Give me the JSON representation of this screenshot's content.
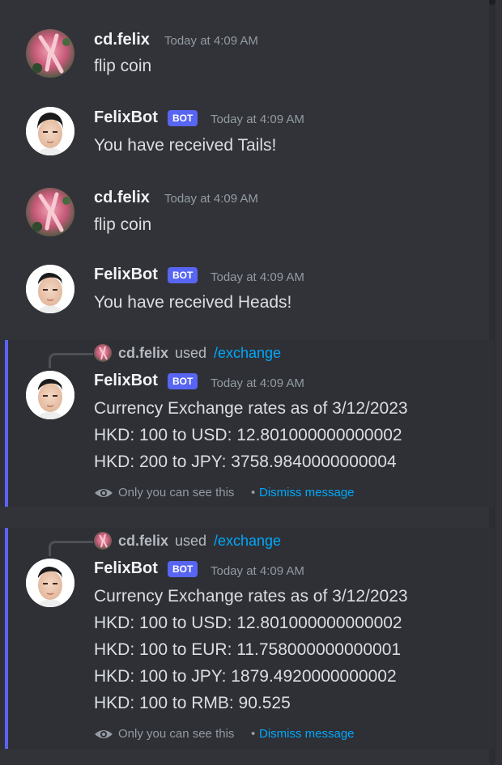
{
  "messages": [
    {
      "user": "cd.felix",
      "time": "Today at 4:09 AM",
      "text": "flip coin"
    },
    {
      "user": "FelixBot",
      "bot_tag": "BOT",
      "time": "Today at 4:09 AM",
      "text": "You have received Tails!"
    },
    {
      "user": "cd.felix",
      "time": "Today at 4:09 AM",
      "text": "flip coin"
    },
    {
      "user": "FelixBot",
      "bot_tag": "BOT",
      "time": "Today at 4:09 AM",
      "text": "You have received Heads!"
    }
  ],
  "exchange1": {
    "reply_user": "cd.felix",
    "reply_used": "used",
    "reply_command": "/exchange",
    "user": "FelixBot",
    "bot_tag": "BOT",
    "time": "Today at 4:09 AM",
    "lines": [
      "Currency Exchange rates as of 3/12/2023",
      "HKD: 100 to USD: 12.801000000000002",
      "HKD: 200 to JPY: 3758.9840000000004"
    ],
    "only_you": "Only you can see this",
    "separator": "•",
    "dismiss": "Dismiss message"
  },
  "exchange2": {
    "reply_user": "cd.felix",
    "reply_used": "used",
    "reply_command": "/exchange",
    "user": "FelixBot",
    "bot_tag": "BOT",
    "time": "Today at 4:09 AM",
    "lines": [
      "Currency Exchange rates as of 3/12/2023",
      "HKD: 100 to USD: 12.801000000000002",
      "HKD: 100 to EUR: 11.758000000000001",
      "HKD: 100 to JPY: 1879.4920000000002",
      "HKD: 100 to RMB: 90.525"
    ],
    "only_you": "Only you can see this",
    "separator": "•",
    "dismiss": "Dismiss message"
  },
  "icons": {
    "eye": "eye-icon",
    "avatar_user": "avatar-cd-felix",
    "avatar_bot": "avatar-felixbot"
  },
  "colors": {
    "background": "#313338",
    "ephemeral": "#2e3035",
    "accent": "#5865f2",
    "link": "#00a8fc"
  }
}
